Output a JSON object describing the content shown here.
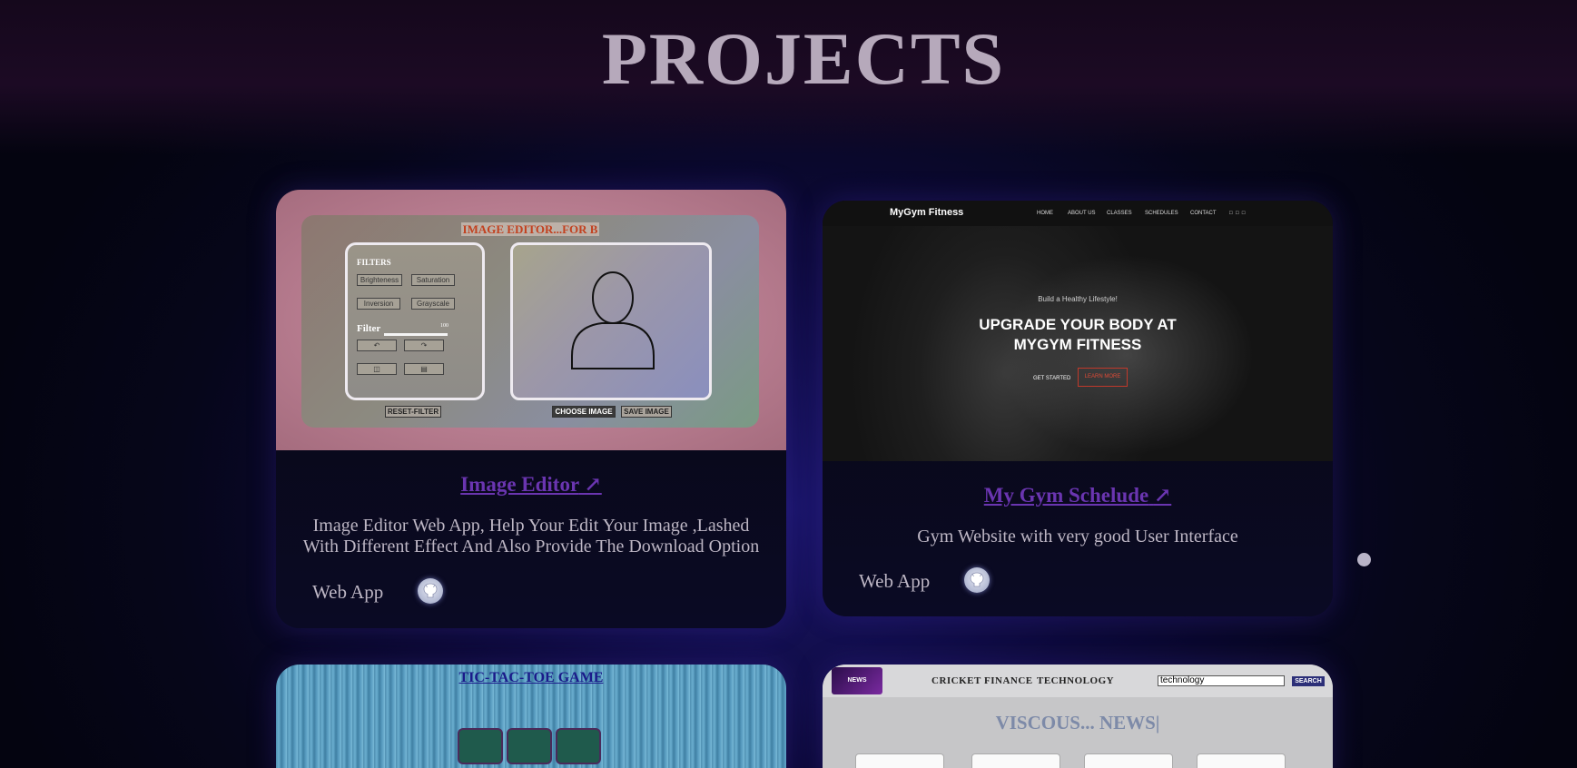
{
  "page": {
    "title": "PROJECTS"
  },
  "projects": [
    {
      "title": "Image Editor",
      "link_icon": "arrow-up-right-icon",
      "description": "Image Editor Web App, Help Your Edit Your Image ,Lashed With Different Effect And Also Provide The Download Option",
      "tag": "Web App",
      "repo_icon": "github-icon",
      "preview": {
        "header": "IMAGE EDITOR...FOR B",
        "filters_label": "FILTERS",
        "filter_buttons": [
          "Brighteness",
          "Saturation",
          "Inversion",
          "Grayscale"
        ],
        "filter_label": "Filter",
        "filter_value": "100",
        "reset_label": "RESET-FILTER",
        "choose_label": "CHOOSE IMAGE",
        "save_label": "SAVE IMAGE"
      }
    },
    {
      "title": "My Gym Schelude",
      "link_icon": "arrow-up-right-icon",
      "description": "Gym Website with very good User Interface",
      "tag": "Web App",
      "repo_icon": "github-icon",
      "preview": {
        "logo": "MyGym Fitness",
        "nav": [
          "HOME",
          "ABOUT US",
          "CLASSES",
          "SCHEDULES",
          "CONTACT"
        ],
        "subtitle": "Build a Healthy Lifestyle!",
        "headline_1": "UPGRADE YOUR BODY AT",
        "headline_2": "MYGYM FITNESS",
        "cta_primary": "GET STARTED",
        "cta_secondary": "LEARN MORE"
      }
    },
    {
      "preview": {
        "title": "TIC-TAC-TOE GAME"
      }
    },
    {
      "preview": {
        "logo": "NEWS",
        "nav": [
          "CRICKET",
          "FINANCE",
          "TECHNOLOGY"
        ],
        "search_value": "technology",
        "search_label": "SEARCH",
        "headline": "VISCOUS... NEWS|"
      }
    }
  ]
}
